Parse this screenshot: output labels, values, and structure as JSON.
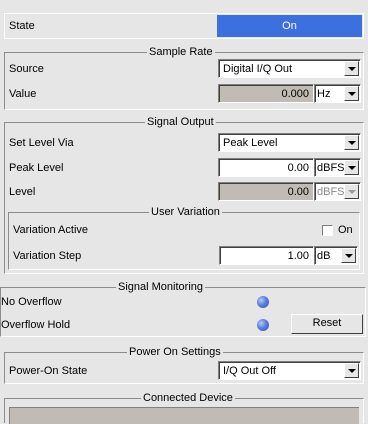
{
  "state": {
    "label": "State",
    "value": "On",
    "value_color": "#3c6fe0"
  },
  "sample_rate": {
    "title": "Sample Rate",
    "source_label": "Source",
    "source_value": "Digital I/Q Out",
    "value_label": "Value",
    "value_value": "0.000",
    "value_unit": "Hz"
  },
  "signal_output": {
    "title": "Signal Output",
    "set_level_via_label": "Set Level Via",
    "set_level_via_value": "Peak Level",
    "peak_level_label": "Peak Level",
    "peak_level_value": "0.00",
    "peak_level_unit": "dBFS",
    "level_label": "Level",
    "level_value": "0.00",
    "level_unit": "dBFS",
    "user_variation": {
      "title": "User Variation",
      "variation_active_label": "Variation Active",
      "variation_active_check_label": "On",
      "variation_step_label": "Variation Step",
      "variation_step_value": "1.00",
      "variation_step_unit": "dB"
    }
  },
  "signal_monitoring": {
    "title": "Signal Monitoring",
    "no_overflow_label": "No Overflow",
    "overflow_hold_label": "Overflow Hold",
    "reset_label": "Reset",
    "led_color": "#4a70d8"
  },
  "power_on": {
    "title": "Power On Settings",
    "state_label": "Power-On State",
    "state_value": "I/Q Out Off"
  },
  "connected_device": {
    "title": "Connected Device"
  }
}
